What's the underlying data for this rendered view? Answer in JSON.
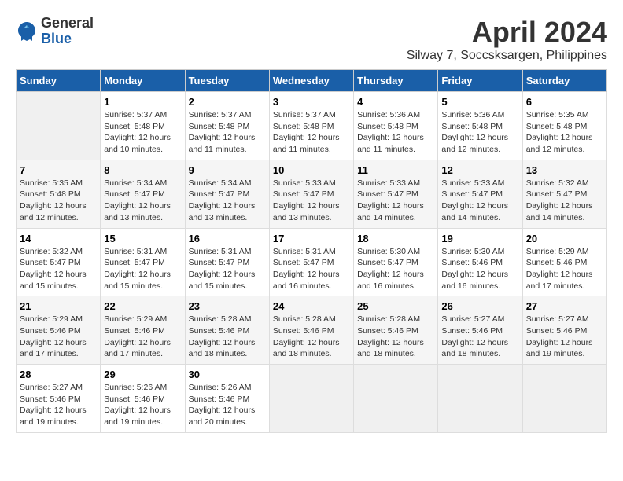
{
  "header": {
    "logo": {
      "general": "General",
      "blue": "Blue"
    },
    "title": "April 2024",
    "subtitle": "Silway 7, Soccsksargen, Philippines"
  },
  "calendar": {
    "days_of_week": [
      "Sunday",
      "Monday",
      "Tuesday",
      "Wednesday",
      "Thursday",
      "Friday",
      "Saturday"
    ],
    "weeks": [
      [
        {
          "day": "",
          "empty": true
        },
        {
          "day": "1",
          "sunrise": "Sunrise: 5:37 AM",
          "sunset": "Sunset: 5:48 PM",
          "daylight": "Daylight: 12 hours and 10 minutes."
        },
        {
          "day": "2",
          "sunrise": "Sunrise: 5:37 AM",
          "sunset": "Sunset: 5:48 PM",
          "daylight": "Daylight: 12 hours and 11 minutes."
        },
        {
          "day": "3",
          "sunrise": "Sunrise: 5:37 AM",
          "sunset": "Sunset: 5:48 PM",
          "daylight": "Daylight: 12 hours and 11 minutes."
        },
        {
          "day": "4",
          "sunrise": "Sunrise: 5:36 AM",
          "sunset": "Sunset: 5:48 PM",
          "daylight": "Daylight: 12 hours and 11 minutes."
        },
        {
          "day": "5",
          "sunrise": "Sunrise: 5:36 AM",
          "sunset": "Sunset: 5:48 PM",
          "daylight": "Daylight: 12 hours and 12 minutes."
        },
        {
          "day": "6",
          "sunrise": "Sunrise: 5:35 AM",
          "sunset": "Sunset: 5:48 PM",
          "daylight": "Daylight: 12 hours and 12 minutes."
        }
      ],
      [
        {
          "day": "7",
          "sunrise": "Sunrise: 5:35 AM",
          "sunset": "Sunset: 5:48 PM",
          "daylight": "Daylight: 12 hours and 12 minutes."
        },
        {
          "day": "8",
          "sunrise": "Sunrise: 5:34 AM",
          "sunset": "Sunset: 5:47 PM",
          "daylight": "Daylight: 12 hours and 13 minutes."
        },
        {
          "day": "9",
          "sunrise": "Sunrise: 5:34 AM",
          "sunset": "Sunset: 5:47 PM",
          "daylight": "Daylight: 12 hours and 13 minutes."
        },
        {
          "day": "10",
          "sunrise": "Sunrise: 5:33 AM",
          "sunset": "Sunset: 5:47 PM",
          "daylight": "Daylight: 12 hours and 13 minutes."
        },
        {
          "day": "11",
          "sunrise": "Sunrise: 5:33 AM",
          "sunset": "Sunset: 5:47 PM",
          "daylight": "Daylight: 12 hours and 14 minutes."
        },
        {
          "day": "12",
          "sunrise": "Sunrise: 5:33 AM",
          "sunset": "Sunset: 5:47 PM",
          "daylight": "Daylight: 12 hours and 14 minutes."
        },
        {
          "day": "13",
          "sunrise": "Sunrise: 5:32 AM",
          "sunset": "Sunset: 5:47 PM",
          "daylight": "Daylight: 12 hours and 14 minutes."
        }
      ],
      [
        {
          "day": "14",
          "sunrise": "Sunrise: 5:32 AM",
          "sunset": "Sunset: 5:47 PM",
          "daylight": "Daylight: 12 hours and 15 minutes."
        },
        {
          "day": "15",
          "sunrise": "Sunrise: 5:31 AM",
          "sunset": "Sunset: 5:47 PM",
          "daylight": "Daylight: 12 hours and 15 minutes."
        },
        {
          "day": "16",
          "sunrise": "Sunrise: 5:31 AM",
          "sunset": "Sunset: 5:47 PM",
          "daylight": "Daylight: 12 hours and 15 minutes."
        },
        {
          "day": "17",
          "sunrise": "Sunrise: 5:31 AM",
          "sunset": "Sunset: 5:47 PM",
          "daylight": "Daylight: 12 hours and 16 minutes."
        },
        {
          "day": "18",
          "sunrise": "Sunrise: 5:30 AM",
          "sunset": "Sunset: 5:47 PM",
          "daylight": "Daylight: 12 hours and 16 minutes."
        },
        {
          "day": "19",
          "sunrise": "Sunrise: 5:30 AM",
          "sunset": "Sunset: 5:46 PM",
          "daylight": "Daylight: 12 hours and 16 minutes."
        },
        {
          "day": "20",
          "sunrise": "Sunrise: 5:29 AM",
          "sunset": "Sunset: 5:46 PM",
          "daylight": "Daylight: 12 hours and 17 minutes."
        }
      ],
      [
        {
          "day": "21",
          "sunrise": "Sunrise: 5:29 AM",
          "sunset": "Sunset: 5:46 PM",
          "daylight": "Daylight: 12 hours and 17 minutes."
        },
        {
          "day": "22",
          "sunrise": "Sunrise: 5:29 AM",
          "sunset": "Sunset: 5:46 PM",
          "daylight": "Daylight: 12 hours and 17 minutes."
        },
        {
          "day": "23",
          "sunrise": "Sunrise: 5:28 AM",
          "sunset": "Sunset: 5:46 PM",
          "daylight": "Daylight: 12 hours and 18 minutes."
        },
        {
          "day": "24",
          "sunrise": "Sunrise: 5:28 AM",
          "sunset": "Sunset: 5:46 PM",
          "daylight": "Daylight: 12 hours and 18 minutes."
        },
        {
          "day": "25",
          "sunrise": "Sunrise: 5:28 AM",
          "sunset": "Sunset: 5:46 PM",
          "daylight": "Daylight: 12 hours and 18 minutes."
        },
        {
          "day": "26",
          "sunrise": "Sunrise: 5:27 AM",
          "sunset": "Sunset: 5:46 PM",
          "daylight": "Daylight: 12 hours and 18 minutes."
        },
        {
          "day": "27",
          "sunrise": "Sunrise: 5:27 AM",
          "sunset": "Sunset: 5:46 PM",
          "daylight": "Daylight: 12 hours and 19 minutes."
        }
      ],
      [
        {
          "day": "28",
          "sunrise": "Sunrise: 5:27 AM",
          "sunset": "Sunset: 5:46 PM",
          "daylight": "Daylight: 12 hours and 19 minutes."
        },
        {
          "day": "29",
          "sunrise": "Sunrise: 5:26 AM",
          "sunset": "Sunset: 5:46 PM",
          "daylight": "Daylight: 12 hours and 19 minutes."
        },
        {
          "day": "30",
          "sunrise": "Sunrise: 5:26 AM",
          "sunset": "Sunset: 5:46 PM",
          "daylight": "Daylight: 12 hours and 20 minutes."
        },
        {
          "day": "",
          "empty": true
        },
        {
          "day": "",
          "empty": true
        },
        {
          "day": "",
          "empty": true
        },
        {
          "day": "",
          "empty": true
        }
      ]
    ]
  }
}
